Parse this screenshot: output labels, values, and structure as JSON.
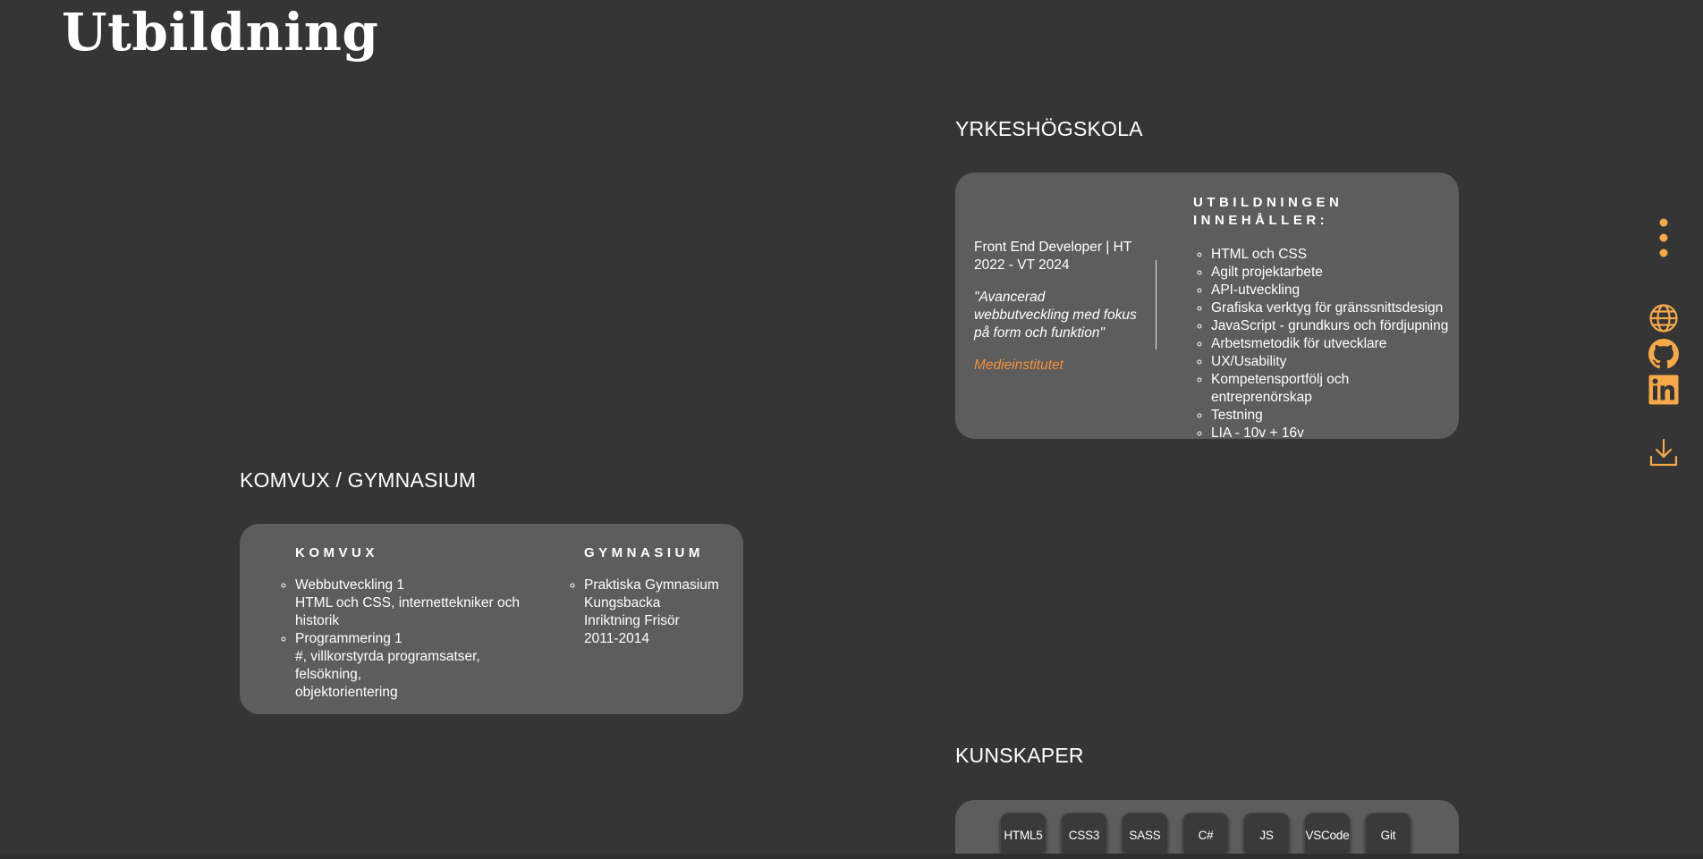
{
  "page": {
    "title": "Utbildning"
  },
  "yh": {
    "heading": "YRKESHÖGSKOLA",
    "program_line1": "Front End Developer | HT",
    "program_line2": "2022 - VT 2024",
    "quote_line1": "\"Avancerad",
    "quote_line2": "webbutveckling med fokus",
    "quote_line3": "på form och funktion\"",
    "school": "Medieinstitutet",
    "contents_heading_line1": "UTBILDNINGEN",
    "contents_heading_line2": "INNEHÅLLER:",
    "contents": [
      "HTML och CSS",
      "Agilt projektarbete",
      "API-utveckling",
      "Grafiska verktyg för gränssnittsdesign",
      "JavaScript - grundkurs och fördjupning",
      "Arbetsmetodik för utvecklare",
      "UX/Usability",
      "Kompetensportfölj och entreprenörskap",
      "Testning",
      "LIA - 10v + 16v"
    ]
  },
  "komvux": {
    "heading": "KOMVUX / GYMNASIUM",
    "komvux_heading": "KOMVUX",
    "course1_title": "Webbutveckling 1",
    "course1_desc1": "HTML och CSS, internettekniker och",
    "course1_desc2": "historik",
    "course2_title": "Programmering 1",
    "course2_desc1": "#, villkorstyrda programsatser, felsökning,",
    "course2_desc2": "objektorientering",
    "gymnasium_heading": "GYMNASIUM",
    "gym_line1": "Praktiska Gymnasium",
    "gym_line2": "Kungsbacka",
    "gym_line3": "Inriktning Frisör",
    "gym_line4": "2011-2014"
  },
  "skills": {
    "heading": "KUNSKAPER",
    "items": [
      "HTML5",
      "CSS3",
      "SASS",
      "C#",
      "JS",
      "VSCode",
      "Git"
    ]
  },
  "colors": {
    "background": "#353535",
    "card": "#5d5d5d",
    "accent": "#f5a94a",
    "link": "#f58f3c"
  },
  "icons": {
    "menu": "kebab-menu-icon",
    "web": "globe-icon",
    "github": "github-icon",
    "linkedin": "linkedin-icon",
    "download": "download-icon"
  }
}
